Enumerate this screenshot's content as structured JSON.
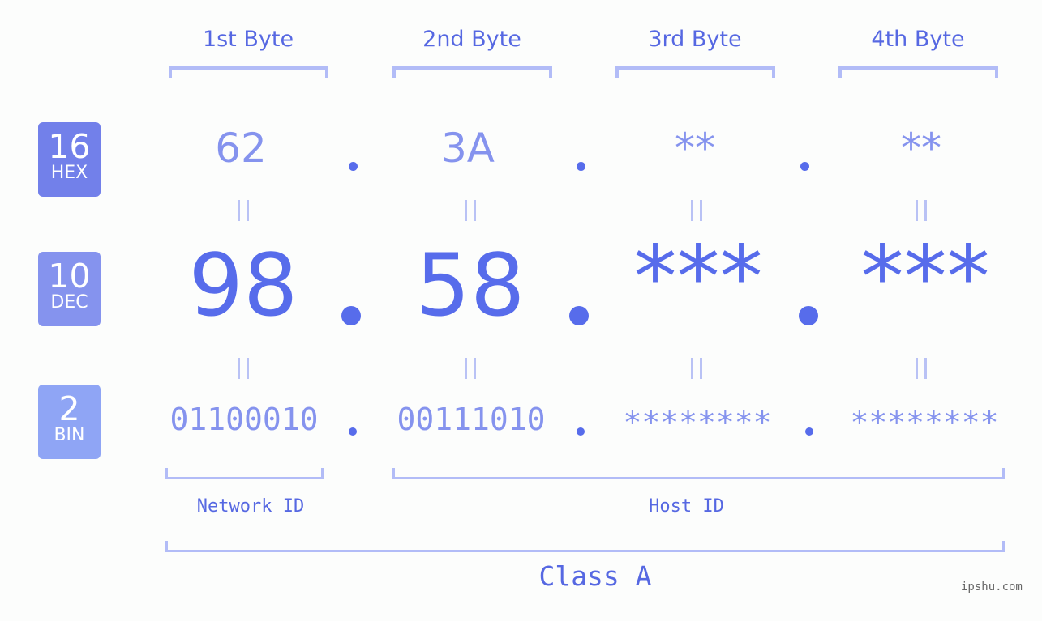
{
  "bytes": [
    {
      "header": "1st Byte",
      "hex": "62",
      "dec": "98",
      "bin": "01100010"
    },
    {
      "header": "2nd Byte",
      "hex": "3A",
      "dec": "58",
      "bin": "00111010"
    },
    {
      "header": "3rd Byte",
      "hex": "**",
      "dec": "***",
      "bin": "********"
    },
    {
      "header": "4th Byte",
      "hex": "**",
      "dec": "***",
      "bin": "********"
    }
  ],
  "badges": {
    "hex": {
      "num": "16",
      "label": "HEX",
      "color": "#7280ea"
    },
    "dec": {
      "num": "10",
      "label": "DEC",
      "color": "#8593ee"
    },
    "bin": {
      "num": "2",
      "label": "BIN",
      "color": "#8fa5f5"
    }
  },
  "segments": {
    "network": "Network ID",
    "host": "Host ID",
    "class": "Class A"
  },
  "watermark": "ipshu.com",
  "colors": {
    "accent": "#576ceb",
    "light": "#8593ee",
    "bracket": "#b2bcf7"
  }
}
